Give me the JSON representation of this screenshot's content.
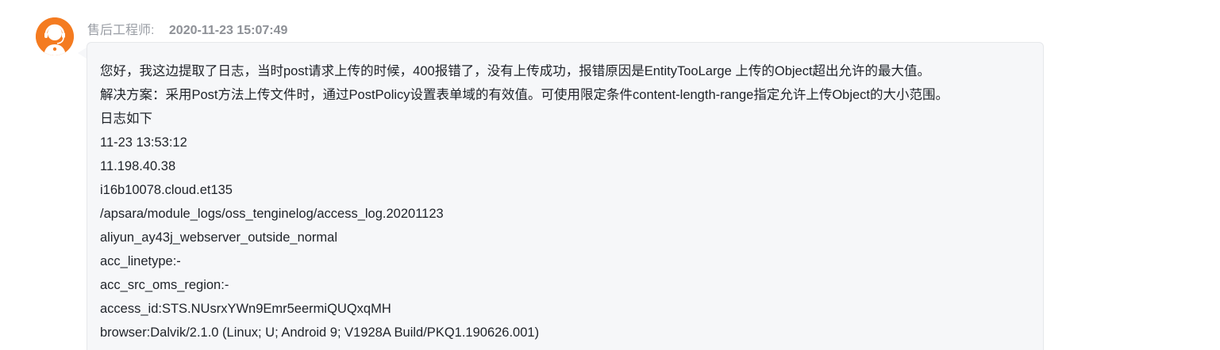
{
  "author": "售后工程师:",
  "timestamp": "2020-11-23 15:07:49",
  "message_lines": [
    "您好，我这边提取了日志，当时post请求上传的时候，400报错了，没有上传成功，报错原因是EntityTooLarge 上传的Object超出允许的最大值。",
    "解决方案：采用Post方法上传文件时，通过PostPolicy设置表单域的有效值。可使用限定条件content-length-range指定允许上传Object的大小范围。",
    "日志如下",
    "11-23 13:53:12",
    "11.198.40.38",
    "i16b10078.cloud.et135",
    "/apsara/module_logs/oss_tenginelog/access_log.20201123",
    "aliyun_ay43j_webserver_outside_normal",
    "acc_linetype:-",
    "acc_src_oms_region:-",
    "access_id:STS.NUsrxYWn9Emr5eermiQUQxqMH",
    "browser:Dalvik/2.1.0 (Linux; U; Android 9; V1928A Build/PKQ1.190626.001)"
  ],
  "colors": {
    "avatar": "#f47b20",
    "bubble_bg": "#f6f7f9",
    "meta_text": "#9a9ea5",
    "body_text": "#1f2329"
  },
  "icons": {
    "avatar": "customer-service-agent-icon"
  }
}
